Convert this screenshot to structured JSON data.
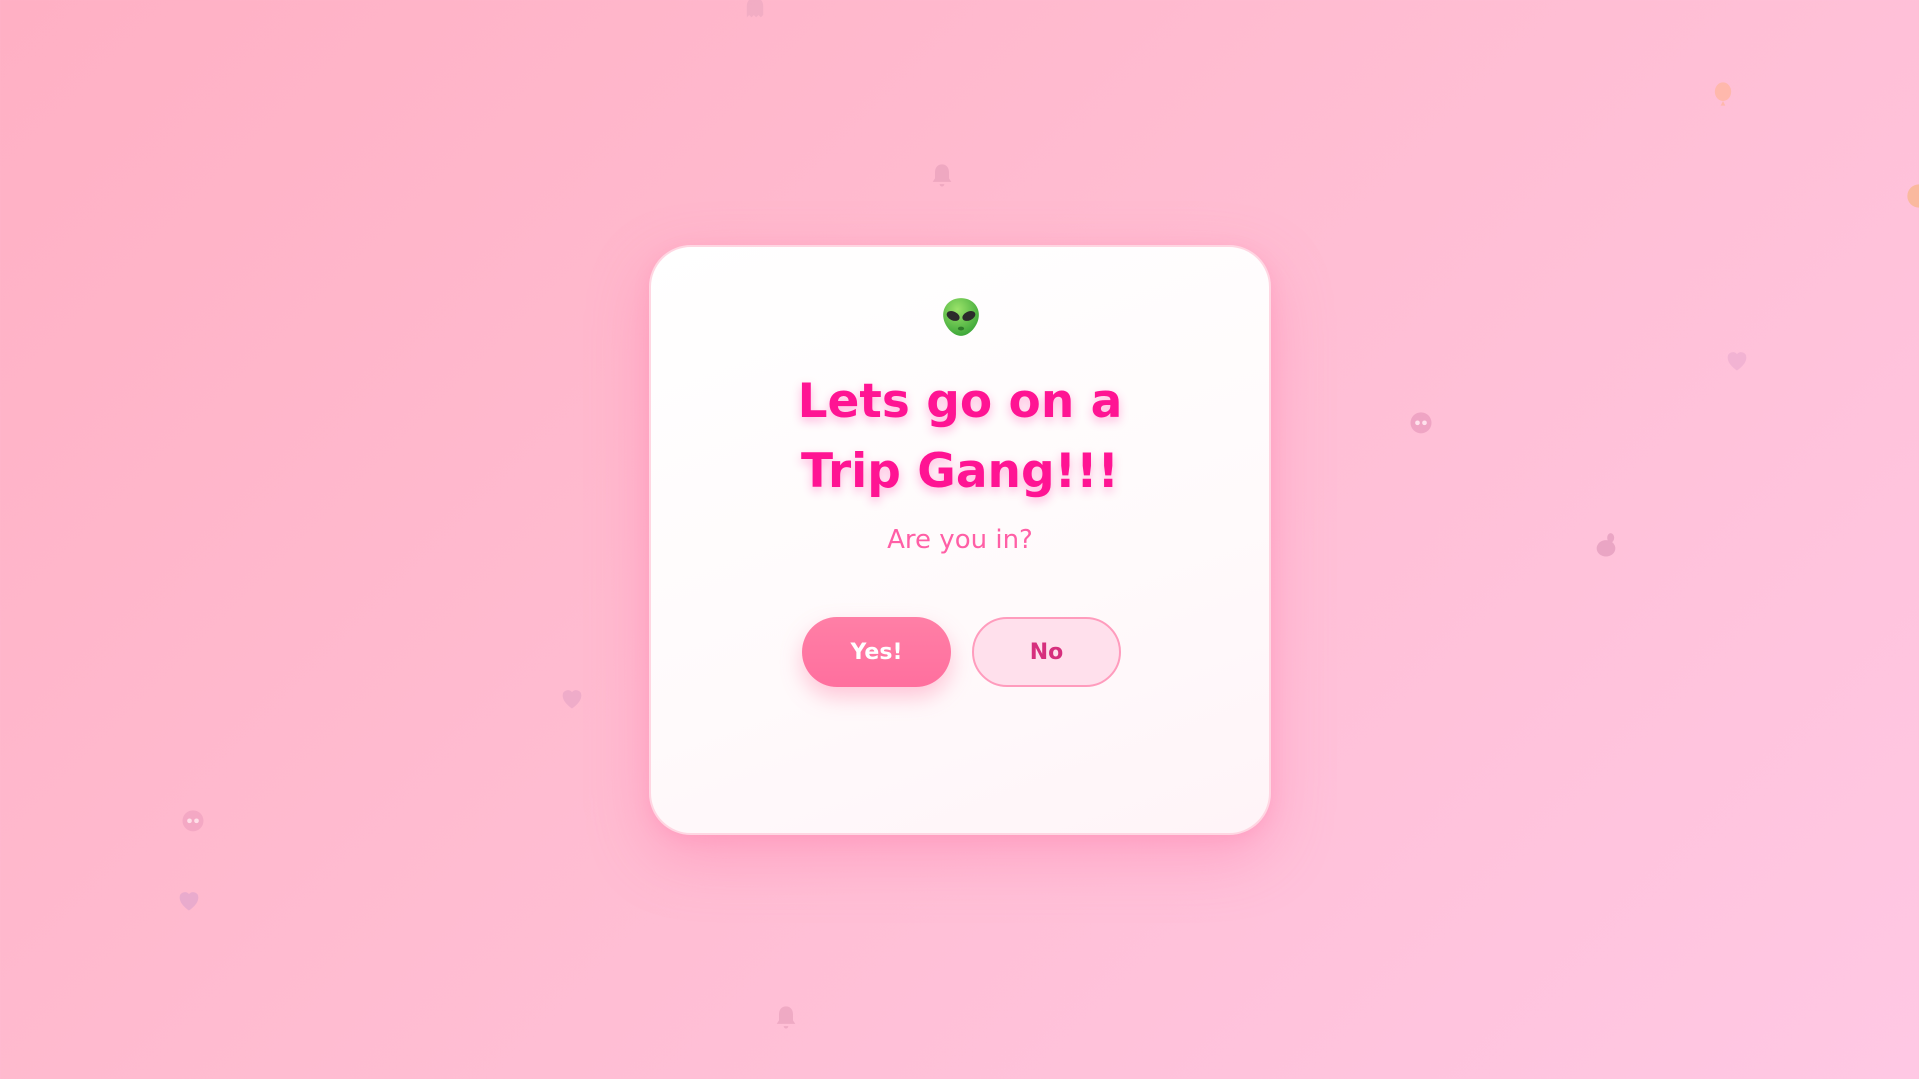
{
  "dialog": {
    "title": "Lets go on a Trip Gang!!!",
    "subtitle": "Are you in?",
    "yes_label": "Yes!",
    "no_label": "No",
    "emoji": "alien-icon"
  },
  "colors": {
    "title": "#ff1493",
    "subtitle": "#ff5fa6",
    "yes_button": "#ff7aa4",
    "no_button_bg": "#ffe0ec",
    "no_button_text": "#d62f7d",
    "background_start": "#ffb0c4",
    "background_end": "#ffc8e4"
  }
}
